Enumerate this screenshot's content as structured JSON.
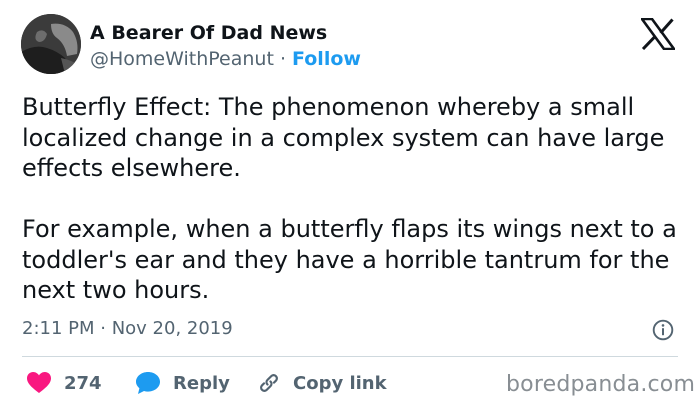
{
  "author": {
    "display_name": "A Bearer Of Dad News",
    "handle": "@HomeWithPeanut",
    "separator": "·",
    "follow_label": "Follow",
    "avatar_icon": "profile-photo-avatar"
  },
  "platform": {
    "logo_icon": "x-logo-icon"
  },
  "tweet": {
    "paragraphs": [
      "Butterfly Effect: The phenomenon whereby a small localized change in a complex system can have large effects elsewhere.",
      "For example, when a butterfly flaps its wings next to a toddler's ear and they have a horrible tantrum for the next two hours."
    ],
    "timestamp": "2:11 PM · Nov 20, 2019",
    "info_icon": "info-icon"
  },
  "actions": {
    "like_count": "274",
    "like_icon": "heart-icon",
    "like_color": "#f91880",
    "reply_label": "Reply",
    "reply_icon": "speech-bubble-icon",
    "reply_color": "#1d9bf0",
    "copy_link_label": "Copy link",
    "copy_link_icon": "link-icon"
  },
  "watermark": {
    "text": "boredpanda.com"
  },
  "colors": {
    "text": "#0f1419",
    "secondary": "#536471",
    "accent": "#1d9bf0",
    "divider": "#cfd9de"
  }
}
